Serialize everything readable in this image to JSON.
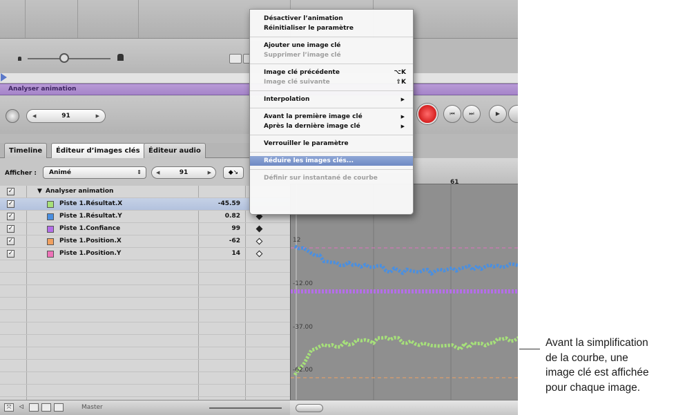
{
  "menu": {
    "items": [
      {
        "label": "Désactiver l’animation",
        "shortcut": "",
        "enabled": true
      },
      {
        "label": "Réinitialiser le paramètre",
        "shortcut": "",
        "enabled": true
      },
      {
        "label": "Ajouter une image clé",
        "shortcut": "",
        "enabled": true
      },
      {
        "label": "Supprimer l’image clé",
        "shortcut": "",
        "enabled": false
      },
      {
        "label": "Image clé précédente",
        "shortcut": "⌥K",
        "enabled": true
      },
      {
        "label": "Image clé suivante",
        "shortcut": "⇧K",
        "enabled": false
      },
      {
        "label": "Interpolation",
        "shortcut": "",
        "enabled": true
      },
      {
        "label": "Avant la première image clé",
        "shortcut": "",
        "enabled": true
      },
      {
        "label": "Après la dernière image clé",
        "shortcut": "",
        "enabled": true
      },
      {
        "label": "Verrouiller le paramètre",
        "shortcut": "",
        "enabled": true
      },
      {
        "label": "Réduire les images clés...",
        "shortcut": "",
        "enabled": true
      },
      {
        "label": "Définir sur instantané de courbe",
        "shortcut": "",
        "enabled": false
      }
    ]
  },
  "timeline_bar": {
    "label": "Analyser animation"
  },
  "timecode": {
    "value": "91"
  },
  "tabs": [
    {
      "label": "Timeline"
    },
    {
      "label": "Éditeur d’images clés"
    },
    {
      "label": "Éditeur audio"
    }
  ],
  "filter": {
    "label": "Afficher :",
    "value": "Animé",
    "frame": "91"
  },
  "params": {
    "group": "Analyser animation",
    "rows": [
      {
        "name": "Piste 1.Résultat.X",
        "value": "-45.59",
        "color": "#a6e07a"
      },
      {
        "name": "Piste 1.Résultat.Y",
        "value": "0.82",
        "color": "#4a8fe0"
      },
      {
        "name": "Piste 1.Confiance",
        "value": "99",
        "color": "#b46ee8"
      },
      {
        "name": "Piste 1.Position.X",
        "value": "-62",
        "color": "#f0a060"
      },
      {
        "name": "Piste 1.Position.Y",
        "value": "14",
        "color": "#ee72b8"
      }
    ]
  },
  "footer": {
    "label": "Master"
  },
  "graph": {
    "ruler_label": "61",
    "labels": [
      {
        "text": "12"
      },
      {
        "text": "-12.00"
      },
      {
        "text": "-37.00"
      },
      {
        "text": "-62.00"
      }
    ]
  },
  "callout": {
    "lines": [
      "Avant la simplification",
      "de la courbe, une",
      "image clé est affichée",
      "pour chaque image."
    ]
  },
  "colors": {
    "record": "#d40000",
    "menu_highlight": "#7a93c9",
    "timeline_bar": "#ad8fd0"
  }
}
